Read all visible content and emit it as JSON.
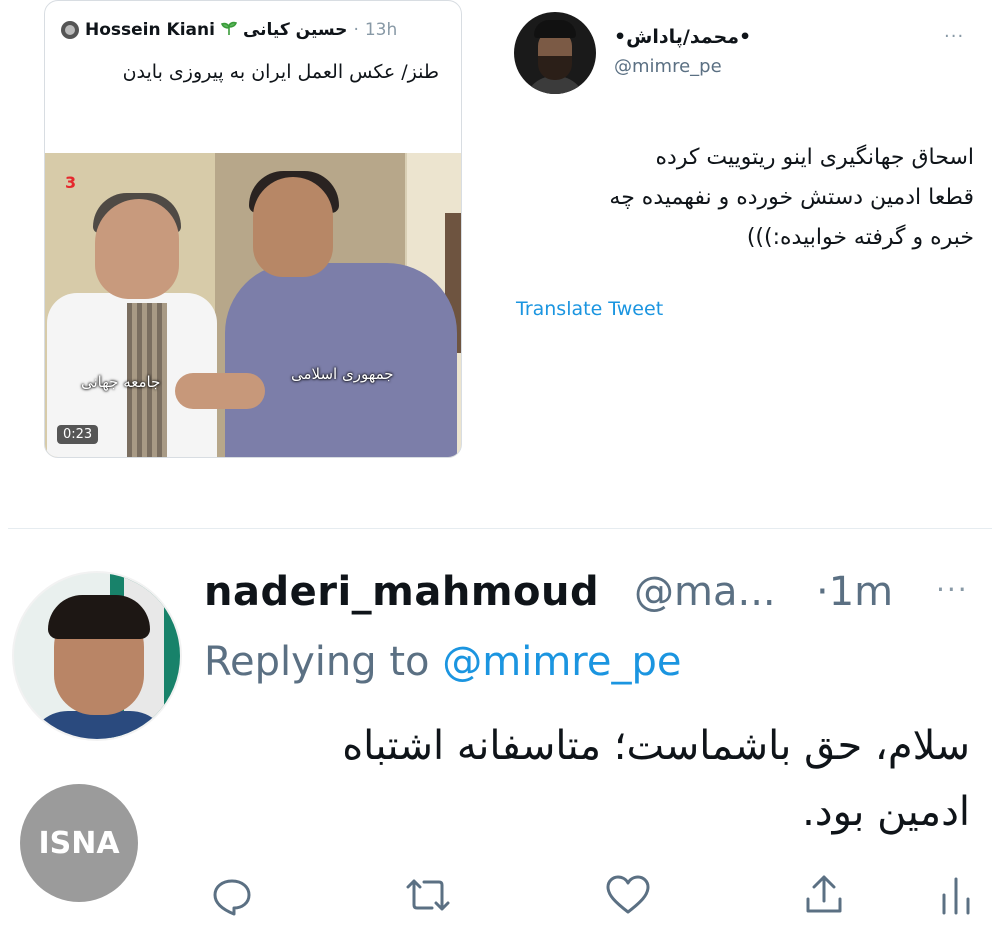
{
  "quoted_tweet": {
    "author_name": "Hossein Kiani",
    "author_name_fa": "حسین کیانی",
    "separator": "·",
    "time": "13h",
    "text": "طنز/ عکس العمل ایران به پیروزی بایدن",
    "video": {
      "channel_logo": "3",
      "label_left": "جامعه جهانی",
      "label_right": "جمهوری اسلامی",
      "duration": "0:23"
    }
  },
  "tweet_right": {
    "author_name": "•محمد/پاداش•",
    "handle": "@mimre_pe",
    "more": "···",
    "lines": [
      "اسحاق جهانگیری اینو ریتوییت کرده",
      "قطعا ادمین دستش خورده و نفهمیده چه",
      "خبره و گرفته خوابیده:)))"
    ],
    "translate": "Translate Tweet"
  },
  "tweet_bottom": {
    "author_name": "naderi_mahmoud",
    "handle": "@ma...",
    "time": "·1m",
    "more": "···",
    "reply_prefix": "Replying to",
    "reply_handle": "@mimre_pe",
    "lines": [
      "سلام، حق باشماست؛ متاسفانه اشتباه",
      "ادمین بود."
    ]
  },
  "watermark": "ISNA",
  "colors": {
    "link": "#1b95e0",
    "secondary": "#5b7083",
    "text": "#0f1419",
    "watermark_bg": "#9b9b9b"
  }
}
